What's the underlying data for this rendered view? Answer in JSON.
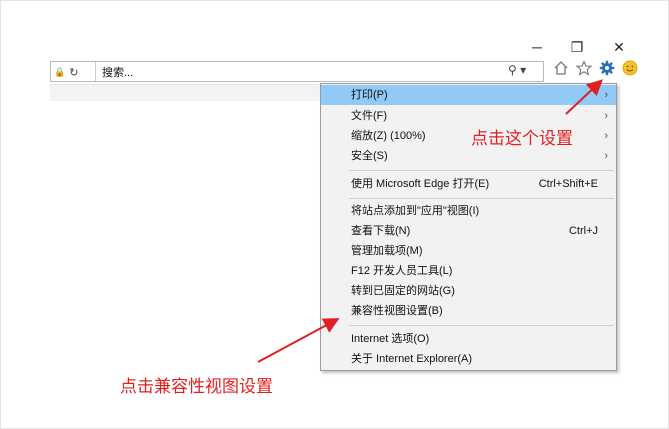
{
  "window": {
    "minimize_glyph": "─",
    "restore_glyph": "❐",
    "close_glyph": "✕"
  },
  "address_bar": {
    "lock_glyph": "🔒",
    "refresh_glyph": "↻",
    "search_placeholder": "搜索...",
    "search_glyph": "⚲ ▾"
  },
  "toolbar": {
    "home_icon": "home-icon",
    "favorites_icon": "star-icon",
    "settings_icon": "gear-icon",
    "feedback_icon": "smiley-icon"
  },
  "menu": {
    "items": [
      {
        "label": "打印(P)",
        "arrow": "›",
        "highlighted": true
      },
      {
        "label": "文件(F)",
        "arrow": "›"
      },
      {
        "label": "缩放(Z) (100%)",
        "arrow": "›"
      },
      {
        "label": "安全(S)",
        "arrow": "›"
      },
      {
        "label": "使用 Microsoft Edge 打开(E)",
        "shortcut": "Ctrl+Shift+E"
      },
      {
        "label": "将站点添加到\"应用\"视图(I)"
      },
      {
        "label": "查看下载(N)",
        "shortcut": "Ctrl+J"
      },
      {
        "label": "管理加载项(M)"
      },
      {
        "label": "F12 开发人员工具(L)"
      },
      {
        "label": "转到已固定的网站(G)"
      },
      {
        "label": "兼容性视图设置(B)"
      },
      {
        "label": "Internet 选项(O)"
      },
      {
        "label": "关于 Internet Explorer(A)"
      }
    ]
  },
  "annotations": {
    "settings_note": "点击这个设置",
    "compat_note": "点击兼容性视图设置",
    "color": "#e02020"
  }
}
